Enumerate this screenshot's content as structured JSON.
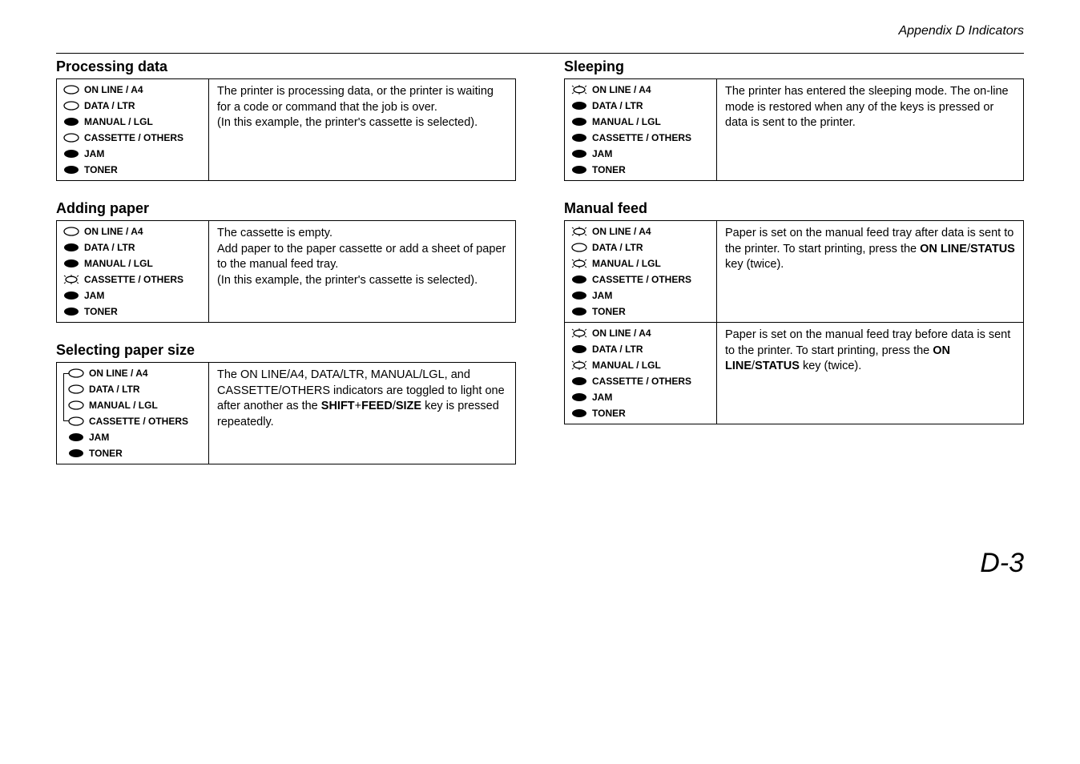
{
  "header": "Appendix D  Indicators",
  "page_number": "D-3",
  "leds": {
    "online": "ON LINE / A4",
    "data": "DATA / LTR",
    "manual": "MANUAL / LGL",
    "cassette": "CASSETTE / OTHERS",
    "jam": "JAM",
    "toner": "TONER"
  },
  "sections": {
    "processing": {
      "title": "Processing data",
      "desc": "The printer is processing data, or the printer is waiting for a code or command that the job is over.\n(In this example, the printer's cassette is selected)."
    },
    "adding": {
      "title": "Adding paper",
      "desc": "The cassette is empty.\nAdd paper to the paper cassette or add a sheet of paper to the manual feed tray.\n(In this example, the printer's cassette is selected)."
    },
    "selecting": {
      "title": "Selecting paper size",
      "desc_parts": {
        "p1": "The ON LINE/A4, DATA/LTR, MANUAL/LGL, and CASSETTE/OTHERS indicators are toggled to light one after another as the ",
        "b1": "SHIFT",
        "plus": "+",
        "b2": "FEED",
        "slash": "/",
        "b3": "SIZE",
        "p2": " key is pressed repeatedly."
      }
    },
    "sleeping": {
      "title": "Sleeping",
      "desc": "The printer has entered the sleeping mode. The on-line mode is restored when any of the keys is pressed or data is sent to the printer."
    },
    "manualfeed": {
      "title": "Manual feed",
      "row1_parts": {
        "p1": "Paper is set on the manual feed tray after data is sent to the printer. To start printing, press the ",
        "b1": "ON LINE",
        "slash": "/",
        "b2": "STATUS",
        "p2": " key (twice)."
      },
      "row2_parts": {
        "p1": "Paper is set on the manual feed tray before data is sent to the printer. To start printing, press the ",
        "b1": "ON",
        "sp": " ",
        "b2": "LINE",
        "slash": "/",
        "b3": "STATUS",
        "p2": " key (twice)."
      }
    }
  }
}
